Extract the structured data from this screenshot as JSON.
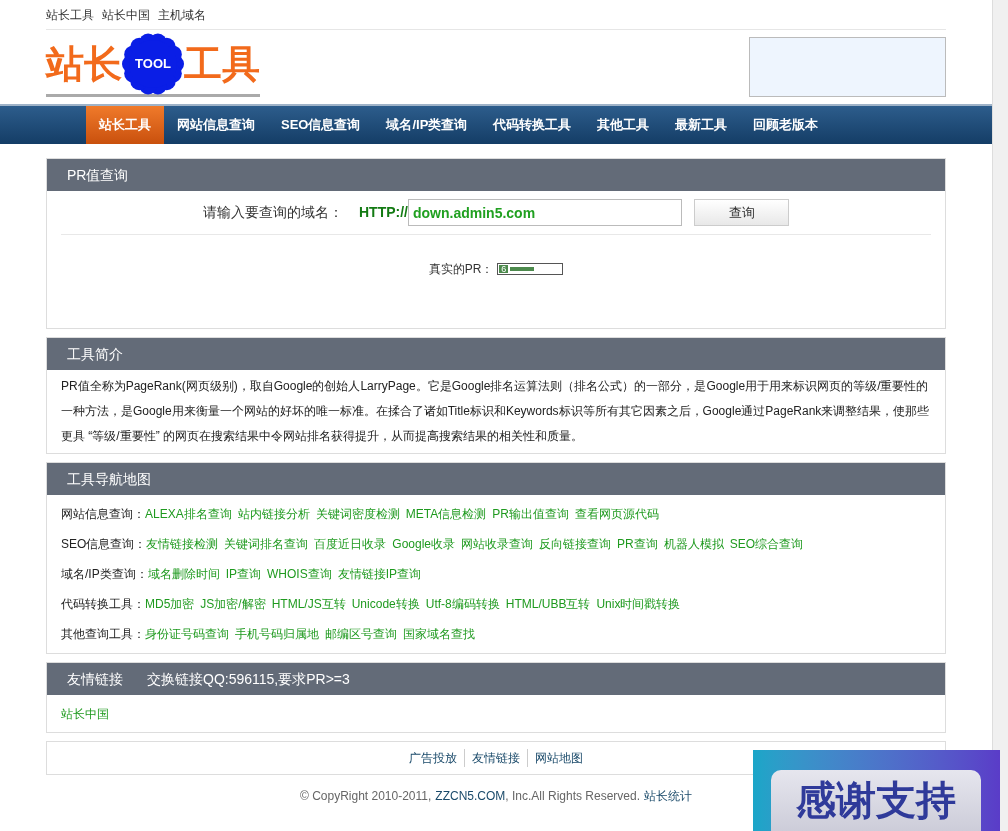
{
  "top_links": [
    "站长工具",
    "站长中国",
    "主机域名"
  ],
  "logo": {
    "left": "站长",
    "badge": "TOOL",
    "right": "工具"
  },
  "nav": [
    {
      "label": "站长工具",
      "selected": true
    },
    {
      "label": "网站信息查询",
      "selected": false
    },
    {
      "label": "SEO信息查询",
      "selected": false
    },
    {
      "label": "域名/IP类查询",
      "selected": false
    },
    {
      "label": "代码转换工具",
      "selected": false
    },
    {
      "label": "其他工具",
      "selected": false
    },
    {
      "label": "最新工具",
      "selected": false
    },
    {
      "label": "回顾老版本",
      "selected": false
    }
  ],
  "query": {
    "title": "PR值查询",
    "label": "请输入要查询的域名：",
    "prefix": "HTTP://",
    "value": "down.admin5.com",
    "button": "查询",
    "result_label": "真实的PR：",
    "pr": "6",
    "level": 0.6
  },
  "intro": {
    "title": "工具简介",
    "text": "PR值全称为PageRank(网页级别)，取自Google的创始人LarryPage。它是Google排名运算法则（排名公式）的一部分，是Google用于用来标识网页的等级/重要性的一种方法，是Google用来衡量一个网站的好坏的唯一标准。在揉合了诸如Title标识和Keywords标识等所有其它因素之后，Google通过PageRank来调整结果，使那些更具 “等级/重要性” 的网页在搜索结果中令网站排名获得提升，从而提高搜索结果的相关性和质量。"
  },
  "sitemap": {
    "title": "工具导航地图",
    "rows": [
      {
        "label": "网站信息查询：",
        "links": [
          "ALEXA排名查询",
          "站内链接分析",
          "关键词密度检测",
          "META信息检测",
          "PR输出值查询",
          "查看网页源代码"
        ]
      },
      {
        "label": "SEO信息查询：",
        "links": [
          "友情链接检测",
          "关键词排名查询",
          "百度近日收录",
          "Google收录",
          "网站收录查询",
          "反向链接查询",
          "PR查询",
          "机器人模拟",
          "SEO综合查询"
        ]
      },
      {
        "label": "域名/IP类查询：",
        "links": [
          "域名删除时间",
          "IP查询",
          "WHOIS查询",
          "友情链接IP查询"
        ]
      },
      {
        "label": "代码转换工具：",
        "links": [
          "MD5加密",
          "JS加密/解密",
          "HTML/JS互转",
          "Unicode转换",
          "Utf-8编码转换",
          "HTML/UBB互转",
          "Unix时间戳转换"
        ]
      },
      {
        "label": "其他查询工具：",
        "links": [
          "身份证号码查询",
          "手机号码归属地",
          "邮编区号查询",
          "国家域名查找"
        ]
      }
    ]
  },
  "friends": {
    "title": "友情链接",
    "note": "交换链接QQ:596115,要求PR>=3",
    "links": [
      "站长中国"
    ]
  },
  "footer_links": [
    "广告投放",
    "友情链接",
    "网站地图"
  ],
  "copyright": {
    "text": "© CopyRight 2010-2011,",
    "site": "ZZCN5.COM",
    "rest": ", Inc.All Rights Reserved.",
    "stats": "站长统计"
  },
  "ad": {
    "text": "感谢支持"
  }
}
